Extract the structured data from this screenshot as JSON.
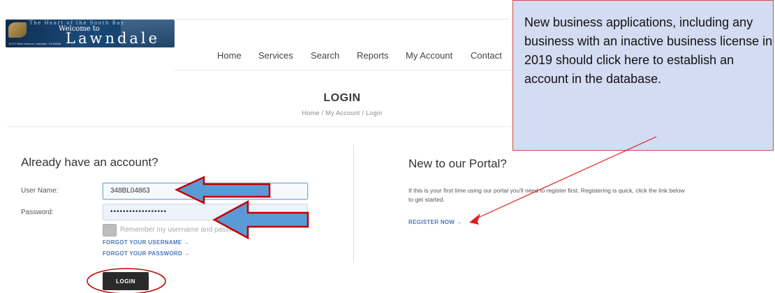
{
  "logo": {
    "tagline": "The Heart of the South Bay",
    "welcome": "Welcome to",
    "city": "Lawndale",
    "address": "14717 Burin Avenue, Lawndale, CA 90260"
  },
  "nav": {
    "items": [
      "Home",
      "Services",
      "Search",
      "Reports",
      "My Account",
      "Contact"
    ]
  },
  "page": {
    "title": "LOGIN",
    "breadcrumb": "Home / My Account / Login"
  },
  "login_form": {
    "heading": "Already have an account?",
    "username_label": "User Name:",
    "username_value": "348BL04863",
    "password_label": "Password:",
    "password_value": "••••••••••••••••••",
    "remember_label": "Remember my username and password",
    "forgot_username": "FORGOT YOUR USERNAME →",
    "forgot_password": "FORGOT YOUR PASSWORD →",
    "login_button": "LOGIN"
  },
  "register": {
    "heading": "New to our Portal?",
    "description": "If this is your first time using our portal you'll need to register first. Registering is quick, click the link below to get started.",
    "link": "REGISTER NOW →"
  },
  "callout": {
    "text": "New business applications, including any business with an inactive business license in 2019 should click here to establish an account in the database."
  },
  "annotation_colors": {
    "arrow_fill": "#5b9bd5",
    "arrow_stroke": "#c00000",
    "ellipse": "#c00000",
    "callout_bg": "#d4dcf3"
  }
}
